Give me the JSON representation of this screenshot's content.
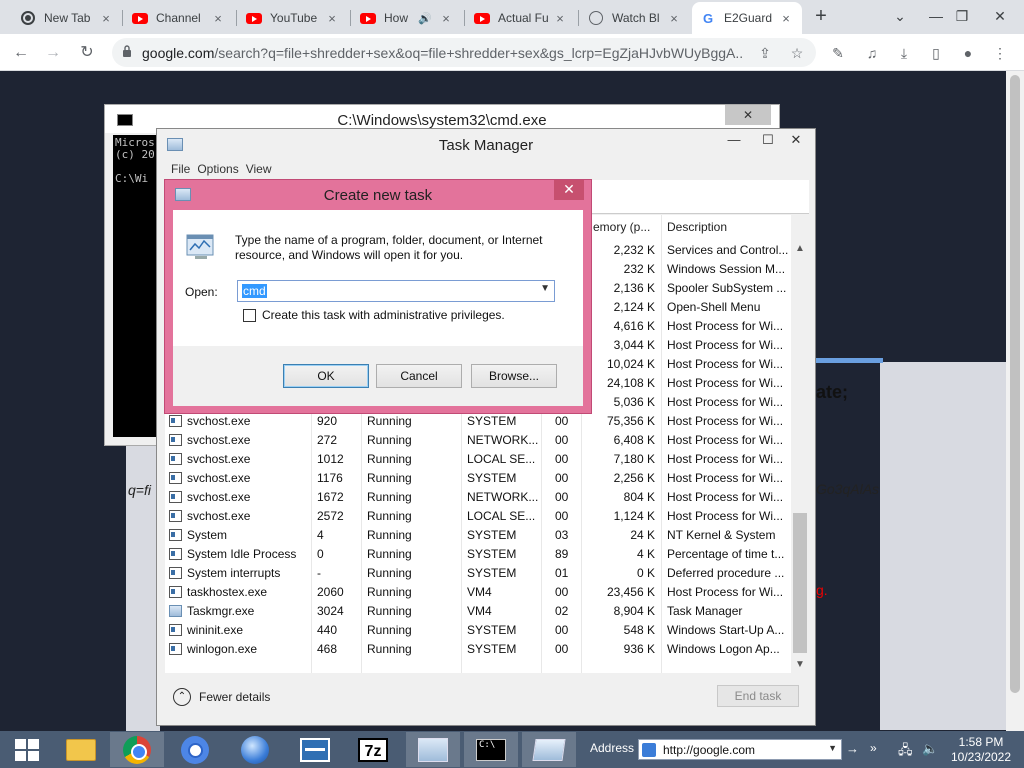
{
  "browser": {
    "tabs": [
      {
        "title": "New Tab",
        "icon": "chrome-ghost-icon",
        "close": "×"
      },
      {
        "title": "Channel",
        "icon": "youtube-icon",
        "close": "×"
      },
      {
        "title": "YouTube",
        "icon": "youtube-icon",
        "close": "×"
      },
      {
        "title": "How",
        "icon": "youtube-icon",
        "close": "×",
        "audio": "🔊"
      },
      {
        "title": "Actual Fu",
        "icon": "youtube-icon",
        "close": "×"
      },
      {
        "title": "Watch Bl",
        "icon": "globe-icon",
        "close": "×"
      },
      {
        "title": "E2Guard",
        "icon": "google-g-icon",
        "close": "×",
        "active": true
      }
    ],
    "new_tab": "+",
    "url_host": "google.com",
    "url_rest": "/search?q=file+shredder+sex&oq=file+shredder+sex&gs_lcrp=EgZjaHJvbWUyBggA...",
    "window_controls": {
      "tab_search": "⌄",
      "minimize": "—",
      "restore": "❐",
      "close": "✕"
    }
  },
  "page": {
    "side_bold": "ate;",
    "side_italic": "Go3qAlAs",
    "side_red": "g.",
    "left_italic": "q=fi"
  },
  "cmd": {
    "title": "C:\\Windows\\system32\\cmd.exe",
    "icon_text": "C:\\",
    "lines": [
      "Micros",
      "(c) 20",
      "",
      "C:\\Wi"
    ],
    "close": "✕"
  },
  "taskmanager": {
    "title": "Task Manager",
    "menu": [
      "File",
      "Options",
      "View"
    ],
    "controls": {
      "minimize": "—",
      "maximize": "☐",
      "close": "✕"
    },
    "columns": {
      "memory": "Memory (p...",
      "description": "Description"
    },
    "rows": [
      {
        "name": "",
        "pid": "",
        "status": "",
        "user": "",
        "cpu": "",
        "mem": "2,232 K",
        "desc": "Services and Control..."
      },
      {
        "name": "",
        "pid": "",
        "status": "",
        "user": "",
        "cpu": "",
        "mem": "232 K",
        "desc": "Windows Session M..."
      },
      {
        "name": "",
        "pid": "",
        "status": "",
        "user": "",
        "cpu": "",
        "mem": "2,136 K",
        "desc": "Spooler SubSystem ..."
      },
      {
        "name": "",
        "pid": "",
        "status": "",
        "user": "",
        "cpu": "",
        "mem": "2,124 K",
        "desc": "Open-Shell Menu"
      },
      {
        "name": "",
        "pid": "",
        "status": "",
        "user": "",
        "cpu": "",
        "mem": "4,616 K",
        "desc": "Host Process for Wi..."
      },
      {
        "name": "",
        "pid": "",
        "status": "",
        "user": "",
        "cpu": "",
        "mem": "3,044 K",
        "desc": "Host Process for Wi..."
      },
      {
        "name": "",
        "pid": "",
        "status": "",
        "user": "",
        "cpu": "",
        "mem": "10,024 K",
        "desc": "Host Process for Wi..."
      },
      {
        "name": "",
        "pid": "",
        "status": "",
        "user": "",
        "cpu": "",
        "mem": "24,108 K",
        "desc": "Host Process for Wi..."
      },
      {
        "name": "",
        "pid": "",
        "status": "",
        "user": "",
        "cpu": "",
        "mem": "5,036 K",
        "desc": "Host Process for Wi..."
      },
      {
        "name": "svchost.exe",
        "pid": "920",
        "status": "Running",
        "user": "SYSTEM",
        "cpu": "00",
        "mem": "75,356 K",
        "desc": "Host Process for Wi..."
      },
      {
        "name": "svchost.exe",
        "pid": "272",
        "status": "Running",
        "user": "NETWORK...",
        "cpu": "00",
        "mem": "6,408 K",
        "desc": "Host Process for Wi..."
      },
      {
        "name": "svchost.exe",
        "pid": "1012",
        "status": "Running",
        "user": "LOCAL SE...",
        "cpu": "00",
        "mem": "7,180 K",
        "desc": "Host Process for Wi..."
      },
      {
        "name": "svchost.exe",
        "pid": "1176",
        "status": "Running",
        "user": "SYSTEM",
        "cpu": "00",
        "mem": "2,256 K",
        "desc": "Host Process for Wi..."
      },
      {
        "name": "svchost.exe",
        "pid": "1672",
        "status": "Running",
        "user": "NETWORK...",
        "cpu": "00",
        "mem": "804 K",
        "desc": "Host Process for Wi..."
      },
      {
        "name": "svchost.exe",
        "pid": "2572",
        "status": "Running",
        "user": "LOCAL SE...",
        "cpu": "00",
        "mem": "1,124 K",
        "desc": "Host Process for Wi..."
      },
      {
        "name": "System",
        "pid": "4",
        "status": "Running",
        "user": "SYSTEM",
        "cpu": "03",
        "mem": "24 K",
        "desc": "NT Kernel & System"
      },
      {
        "name": "System Idle Process",
        "pid": "0",
        "status": "Running",
        "user": "SYSTEM",
        "cpu": "89",
        "mem": "4 K",
        "desc": "Percentage of time t..."
      },
      {
        "name": "System interrupts",
        "pid": "-",
        "status": "Running",
        "user": "SYSTEM",
        "cpu": "01",
        "mem": "0 K",
        "desc": "Deferred procedure ..."
      },
      {
        "name": "taskhostex.exe",
        "pid": "2060",
        "status": "Running",
        "user": "VM4",
        "cpu": "00",
        "mem": "23,456 K",
        "desc": "Host Process for Wi..."
      },
      {
        "name": "Taskmgr.exe",
        "pid": "3024",
        "status": "Running",
        "user": "VM4",
        "cpu": "02",
        "mem": "8,904 K",
        "desc": "Task Manager",
        "tm": true
      },
      {
        "name": "wininit.exe",
        "pid": "440",
        "status": "Running",
        "user": "SYSTEM",
        "cpu": "00",
        "mem": "548 K",
        "desc": "Windows Start-Up A..."
      },
      {
        "name": "winlogon.exe",
        "pid": "468",
        "status": "Running",
        "user": "SYSTEM",
        "cpu": "00",
        "mem": "936 K",
        "desc": "Windows Logon Ap..."
      }
    ],
    "fewer_details": "Fewer details",
    "end_task": "End task"
  },
  "dialog": {
    "title": "Create new task",
    "close": "✕",
    "instruction": "Type the name of a program, folder, document, or Internet resource, and Windows will open it for you.",
    "open_label": "Open:",
    "open_value": "cmd",
    "admin_label": "Create this task with administrative privileges.",
    "ok": "OK",
    "cancel": "Cancel",
    "browse": "Browse..."
  },
  "taskbar": {
    "address_label": "Address",
    "address_value": "http://google.com",
    "go": "→",
    "more": "»",
    "clock_time": "1:58 PM",
    "clock_date": "10/23/2022",
    "colors": {
      "taskbar": "#4a5c73",
      "dialog_frame": "#e3739b"
    }
  }
}
